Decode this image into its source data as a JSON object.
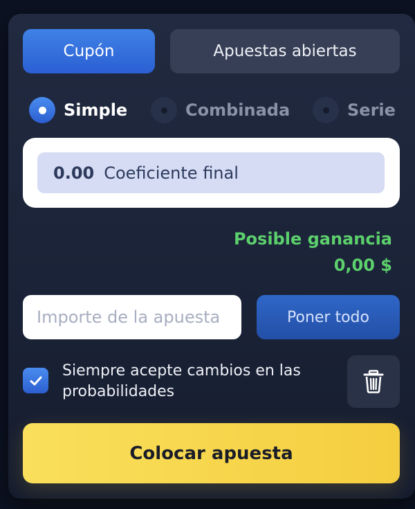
{
  "tabs": [
    {
      "label": "Cupón",
      "active": true
    },
    {
      "label": "Apuestas abiertas",
      "active": false
    }
  ],
  "bet_types": [
    {
      "label": "Simple",
      "selected": true
    },
    {
      "label": "Combinada",
      "selected": false
    },
    {
      "label": "Serie",
      "selected": false
    }
  ],
  "coefficient": {
    "value": "0.00",
    "label": "Coeficiente final"
  },
  "winnings": {
    "label": "Posible ganancia",
    "value": "0,00 $"
  },
  "stake": {
    "placeholder": "Importe de la apuesta",
    "value": "",
    "max_label": "Poner todo"
  },
  "accept_changes": {
    "checked": true,
    "label": "Siempre acepte cambios en las probabilidades"
  },
  "place_bet_label": "Colocar apuesta",
  "icons": {
    "checkbox": "check-icon",
    "delete": "trash-icon"
  },
  "colors": {
    "accent_blue": "#3a78e2",
    "win_green": "#5cd06c",
    "cta_yellow": "#f7d54b",
    "panel_bg": "#1e263a"
  }
}
